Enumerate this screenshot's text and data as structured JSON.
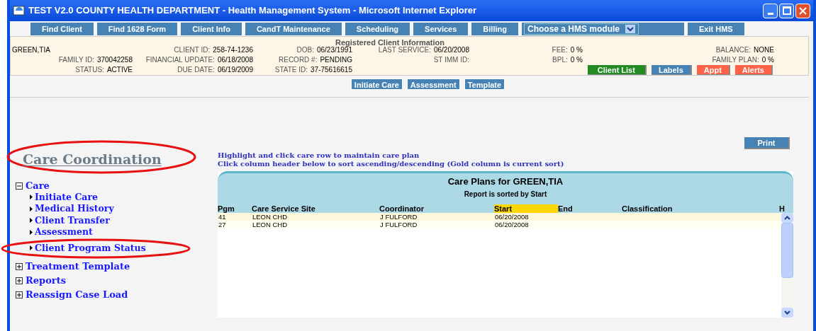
{
  "window": {
    "title": "TEST V2.0 COUNTY HEALTH DEPARTMENT - Health Management System - Microsoft Internet Explorer"
  },
  "nav": [
    {
      "kind": "button",
      "label": "Find Client"
    },
    {
      "kind": "button",
      "label": "Find 1628 Form"
    },
    {
      "kind": "button",
      "label": "Client Info"
    },
    {
      "kind": "button",
      "label": "CandT Maintenance"
    },
    {
      "kind": "button",
      "label": "Scheduling"
    },
    {
      "kind": "button",
      "label": "Services"
    },
    {
      "kind": "button",
      "label": "Billing"
    },
    {
      "kind": "select",
      "label": "Choose a HMS module"
    },
    {
      "kind": "button",
      "label": "Exit HMS"
    }
  ],
  "client_info": {
    "heading": "Registered Client Information",
    "rows": [
      [
        {
          "value": "GREEN,TIA"
        },
        {
          "label": "CLIENT ID:",
          "value": "258-74-1236"
        },
        {
          "label": "DOB:",
          "value": "06/23/1991"
        },
        {
          "label": "LAST SERVICE:",
          "value": "06/20/2008"
        },
        {
          "label": "FEE:",
          "value": "0 %"
        },
        {
          "label": "BALANCE:",
          "value": "NONE"
        }
      ],
      [
        {
          "label": "FAMILY ID:",
          "value": "370042258"
        },
        {
          "label": "FINANCIAL UPDATE:",
          "value": "06/18/2008"
        },
        {
          "label": "RECORD #:",
          "value": "PENDING"
        },
        {
          "label": "ST IMM ID:"
        },
        {
          "label": "BPL:",
          "value": "0 %"
        },
        {
          "label": "FAMILY PLAN:",
          "value": "0 %"
        }
      ],
      [
        {
          "label": "STATUS:",
          "value": "ACTIVE"
        },
        {
          "label": "DUE DATE:",
          "value": "06/19/2009"
        },
        {
          "label": "STATE ID:",
          "value": "37-75616615"
        }
      ]
    ],
    "actions": [
      {
        "label": "Client List",
        "color": "#228b22"
      },
      {
        "label": "Labels",
        "color": "#4682b4"
      },
      {
        "label": "Appt",
        "color": "#ff6347"
      },
      {
        "label": "Alerts",
        "color": "#ff6347"
      }
    ]
  },
  "subnav": [
    "Initiate Care",
    "Assessment",
    "Template"
  ],
  "sidebar": {
    "title": "Care Coordination",
    "title_circled": true,
    "items": [
      {
        "label": "Care",
        "expanded": true,
        "children": [
          {
            "label": "Initiate Care"
          },
          {
            "label": "Medical History"
          },
          {
            "label": "Client Transfer"
          },
          {
            "label": "Assessment"
          },
          {
            "label": "Client Program Status",
            "circled": true
          }
        ]
      },
      {
        "label": "Treatment Template",
        "expanded": false
      },
      {
        "label": "Reports",
        "expanded": false
      },
      {
        "label": "Reassign Case Load",
        "expanded": false
      }
    ]
  },
  "print_button": "Print",
  "instructions": [
    "Highlight and click care row to maintain care plan",
    "Click column header below to sort ascending/descending (Gold column is current sort)"
  ],
  "table": {
    "title": "Care Plans for GREEN,TIA",
    "subtitle": "Report is sorted by Start",
    "columns": [
      {
        "label": "Pgm",
        "selected": false
      },
      {
        "label": "Care Service Site",
        "selected": false
      },
      {
        "label": "Coordinator",
        "selected": false
      },
      {
        "label": "Start",
        "selected": true
      },
      {
        "label": "End",
        "selected": false
      },
      {
        "label": "Classification",
        "selected": false
      },
      {
        "label": "H",
        "selected": false
      }
    ],
    "rows": [
      [
        "41",
        "LEON CHD",
        "J FULFORD",
        "06/20/2008"
      ],
      [
        "27",
        "LEON CHD",
        "J FULFORD",
        "06/20/2008"
      ]
    ]
  }
}
